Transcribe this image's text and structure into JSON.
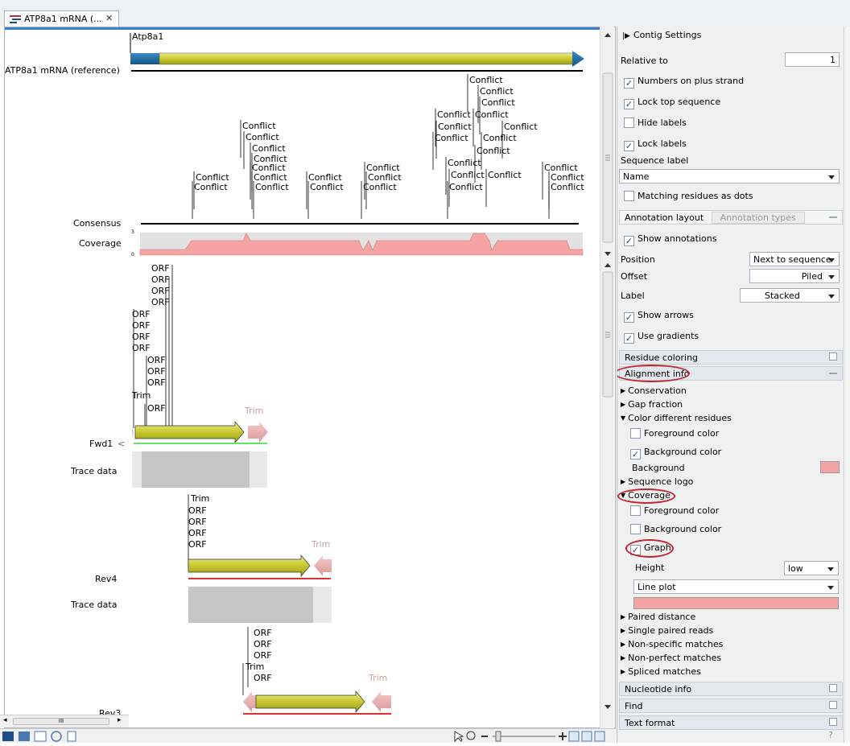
{
  "tab": {
    "title": "ATP8a1 mRNA (...",
    "close": "✕"
  },
  "view": {
    "gene_label": "Atp8a1",
    "reference_label": "ATP8a1 mRNA (reference)",
    "conflict_label": "Conflict",
    "consensus_label": "Consensus",
    "coverage_label": "Coverage",
    "coverage_max": "3",
    "coverage_min": "0",
    "orf_label": "ORF",
    "trim_label": "Trim",
    "fwd1_label": "Fwd1",
    "rev4_label": "Rev4",
    "rev3_label": "Rev3",
    "trace_label": "Trace data",
    "fwd1_arrow": "<"
  },
  "colors": {
    "accent_blue": "#1f6ea8",
    "arrow_yellow": "#c8c830",
    "coverage_pink": "#f5a3a3",
    "highlight_red": "#c0262e",
    "fwd_green": "#66e066",
    "rev_red": "#e03030"
  },
  "panel": {
    "contig_settings": "Contig Settings",
    "relative_to_label": "Relative to",
    "relative_to_value": "1",
    "numbers_on_plus": "Numbers on plus strand",
    "lock_top": "Lock top sequence",
    "hide_labels": "Hide labels",
    "lock_labels": "Lock labels",
    "sequence_label": "Sequence label",
    "sequence_label_value": "Name",
    "matching_dots": "Matching residues as dots",
    "annotation_layout_tab": "Annotation layout",
    "annotation_types_tab": "Annotation types",
    "show_annotations": "Show annotations",
    "position_label": "Position",
    "position_value": "Next to sequence",
    "offset_label": "Offset",
    "offset_value": "Piled",
    "label_label": "Label",
    "label_value": "Stacked",
    "show_arrows": "Show arrows",
    "use_gradients": "Use gradients",
    "residue_coloring": "Residue coloring",
    "alignment_info": "Alignment info",
    "conservation": "Conservation",
    "gap_fraction": "Gap fraction",
    "color_diff": "Color different residues",
    "fg_color": "Foreground color",
    "bg_color": "Background color",
    "background": "Background",
    "sequence_logo": "Sequence logo",
    "coverage": "Coverage",
    "cov_fg": "Foreground color",
    "cov_bg": "Background color",
    "graph": "Graph",
    "height_label": "Height",
    "height_value": "low",
    "plot_value": "Line plot",
    "paired_distance": "Paired distance",
    "single_paired": "Single paired reads",
    "non_specific": "Non-specific matches",
    "non_perfect": "Non-perfect matches",
    "spliced": "Spliced matches",
    "nucleotide_info": "Nucleotide info",
    "find": "Find",
    "text_format": "Text format"
  },
  "bottom": {
    "scroll_mark": "III",
    "help": "?"
  }
}
